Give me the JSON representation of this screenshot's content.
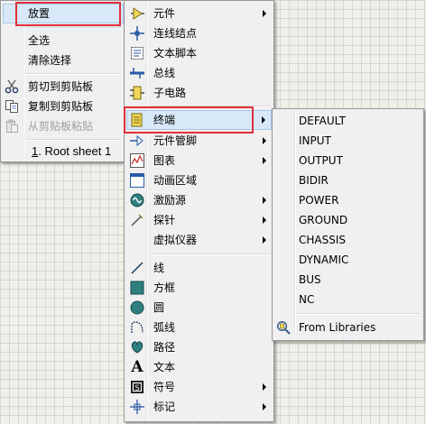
{
  "menu1": {
    "place": "放置",
    "select_all": "全选",
    "clear_selection": "清除选择",
    "cut": "剪切到剪贴板",
    "copy": "复制到剪贴板",
    "paste": "从剪贴板粘贴",
    "root_sheet_num": "1",
    "root_sheet_rest": ". Root sheet 1"
  },
  "menu2": {
    "component": "元件",
    "junction": "连线结点",
    "text_script": "文本脚本",
    "bus": "总线",
    "subcircuit": "子电路",
    "terminal": "终端",
    "device_pin": "元件管脚",
    "graph": "图表",
    "animation_area": "动画区域",
    "generator": "激励源",
    "probe": "探针",
    "virtual_instrument": "虚拟仪器",
    "line": "线",
    "box": "方框",
    "circle": "圆",
    "arc": "弧线",
    "path": "路径",
    "text": "文本",
    "symbol": "符号",
    "marker": "标记"
  },
  "menu3": {
    "items": [
      "DEFAULT",
      "INPUT",
      "OUTPUT",
      "BIDIR",
      "POWER",
      "GROUND",
      "CHASSIS",
      "DYNAMIC",
      "BUS",
      "NC"
    ],
    "from_libraries": "From Libraries"
  },
  "colors": {
    "highlight": "#d8e8f8",
    "red_box": "#e0303a",
    "icon_blue": "#2a5aa8",
    "icon_teal": "#2f7f7f"
  }
}
